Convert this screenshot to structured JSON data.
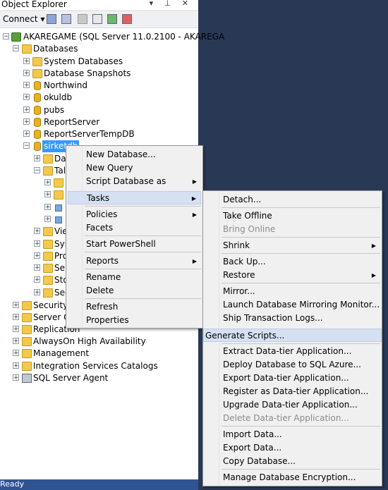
{
  "panel": {
    "title": "Object Explorer",
    "title_icons": "▾ ⊥ ✕",
    "connect_label": "Connect",
    "status": "Ready"
  },
  "tree": {
    "server": "AKAREGAME (SQL Server 11.0.2100 - AKAREGA",
    "databases": "Databases",
    "system_databases": "System Databases",
    "snapshots": "Database Snapshots",
    "db_northwind": "Northwind",
    "db_okuldb": "okuldb",
    "db_pubs": "pubs",
    "db_reportserver": "ReportServer",
    "db_reportservertemp": "ReportServerTempDB",
    "db_selected": "sirketdb",
    "sub_da": "Da",
    "sub_ta": "Tal",
    "sub_vie": "Vie",
    "sub_syn": "Syr",
    "sub_pro": "Pro",
    "sub_ser": "Ser",
    "sub_sto": "Sto",
    "sub_sec": "Sec",
    "security": "Security",
    "server_objects": "Server O",
    "replication": "Replication",
    "alwayson": "AlwaysOn High Availability",
    "management": "Management",
    "integration": "Integration Services Catalogs",
    "agent": "SQL Server Agent"
  },
  "context_menu": {
    "new_database": "New Database...",
    "new_query": "New Query",
    "script_database": "Script Database as",
    "tasks": "Tasks",
    "policies": "Policies",
    "facets": "Facets",
    "powershell": "Start PowerShell",
    "reports": "Reports",
    "rename": "Rename",
    "delete": "Delete",
    "refresh": "Refresh",
    "properties": "Properties"
  },
  "tasks_menu": {
    "detach": "Detach...",
    "take_offline": "Take Offline",
    "bring_online": "Bring Online",
    "shrink": "Shrink",
    "back_up": "Back Up...",
    "restore": "Restore",
    "mirror": "Mirror...",
    "launch_mirroring": "Launch Database Mirroring Monitor...",
    "ship_logs": "Ship Transaction Logs...",
    "generate_scripts": "Generate Scripts...",
    "extract_dac": "Extract Data-tier Application...",
    "deploy_azure": "Deploy Database to SQL Azure...",
    "export_dac": "Export Data-tier Application...",
    "register_dac": "Register as Data-tier Application...",
    "upgrade_dac": "Upgrade Data-tier Application...",
    "delete_dac": "Delete Data-tier Application...",
    "import_data": "Import Data...",
    "export_data": "Export Data...",
    "copy_database": "Copy Database...",
    "manage_encryption": "Manage Database Encryption..."
  }
}
